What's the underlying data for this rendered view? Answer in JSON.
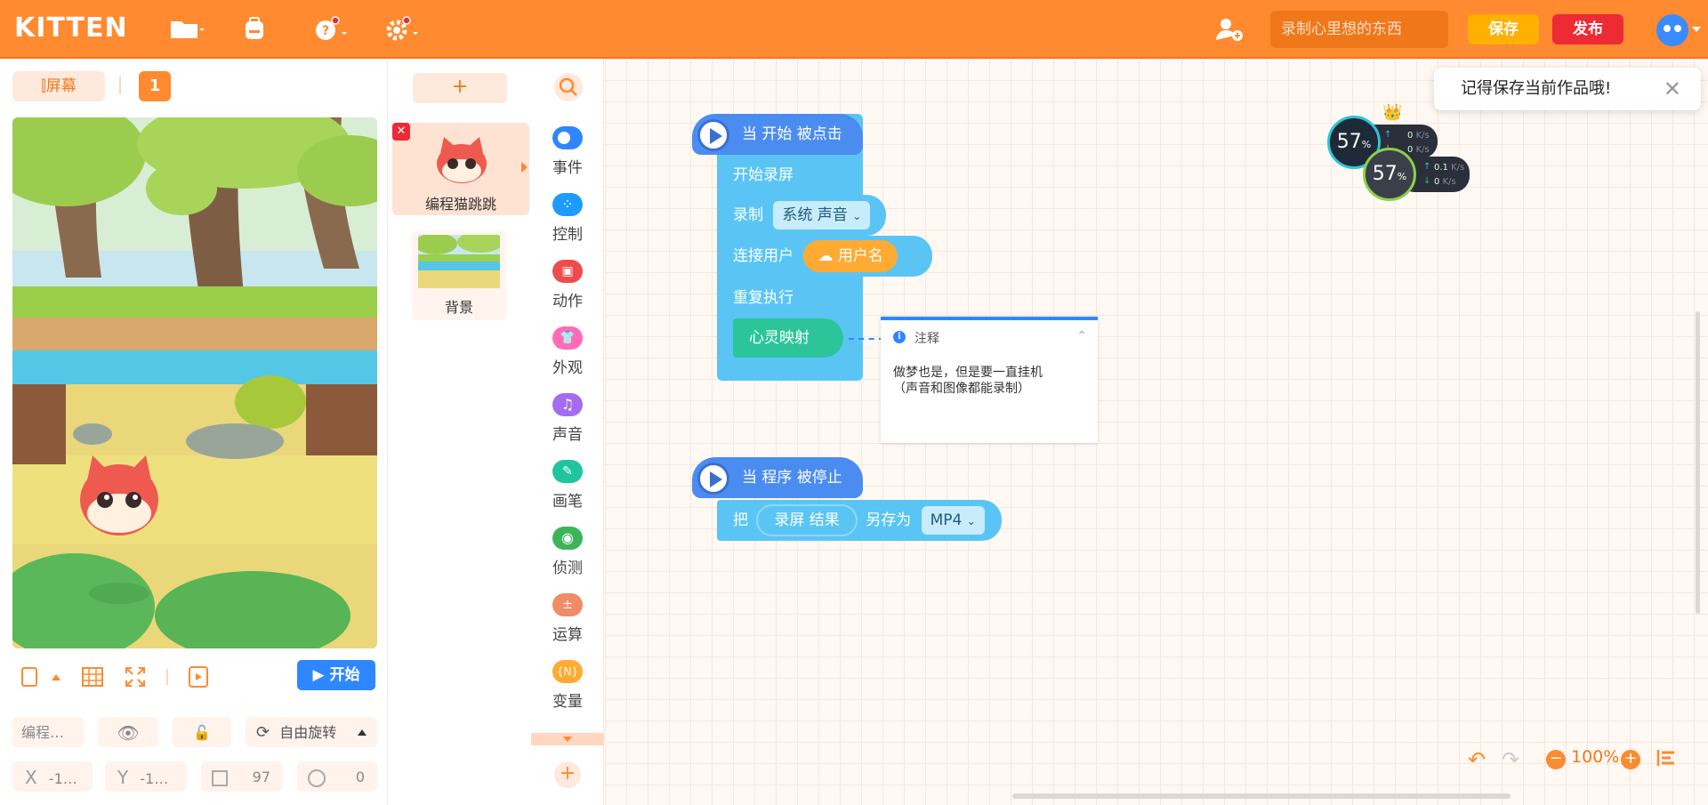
{
  "app": {
    "logo": "KITTEN"
  },
  "header": {
    "search_placeholder": "录制心里想的东西",
    "save_label": "保存",
    "publish_label": "发布"
  },
  "stage_panel": {
    "screen_tab": "屏幕",
    "screen_number": "1",
    "start_label": "开始",
    "sprite_name_short": "编程…",
    "rotation_label": "自由旋转",
    "x_label": "X",
    "x_value": "-1…",
    "y_label": "Y",
    "y_value": "-1…",
    "size_value": "97",
    "direction_value": "0"
  },
  "sprites": {
    "add_label": "+",
    "items": [
      {
        "name": "编程猫跳跳"
      },
      {
        "name": "背景"
      }
    ]
  },
  "categories": [
    {
      "label": "事件",
      "color": "#2f87ff"
    },
    {
      "label": "控制",
      "color": "#1e9bff"
    },
    {
      "label": "动作",
      "color": "#ee4c4c"
    },
    {
      "label": "外观",
      "color": "#ff6bb5"
    },
    {
      "label": "声音",
      "color": "#a46cf0"
    },
    {
      "label": "画笔",
      "color": "#20c5a0"
    },
    {
      "label": "侦测",
      "color": "#3cb55a"
    },
    {
      "label": "运算",
      "color": "#f08c66"
    },
    {
      "label": "变量",
      "color": "#ffaa33"
    }
  ],
  "script1": {
    "hat": "当 开始 被点击",
    "start_record": "开始录屏",
    "record": "录制",
    "record_option": "系统 声音",
    "connect_user": "连接用户",
    "username": "用户名",
    "repeat": "重复执行",
    "mind_map": "心灵映射"
  },
  "note": {
    "title": "注释",
    "line1": "做梦也是，但是要一直挂机",
    "line2": "（声音和图像都能录制）"
  },
  "script2": {
    "hat": "当 程序 被停止",
    "put": "把",
    "result": "录屏 结果",
    "save_as": "另存为",
    "format": "MP4"
  },
  "toast": {
    "text": "记得保存当前作品哦!",
    "close": "✕"
  },
  "monitor": {
    "gauge1_value": "57",
    "gauge2_value": "57",
    "unit": "%",
    "up1": "0",
    "down1": "0",
    "up2": "0.1",
    "down2": "0",
    "rate_unit": "K/s"
  },
  "zoom": {
    "level": "100%"
  }
}
